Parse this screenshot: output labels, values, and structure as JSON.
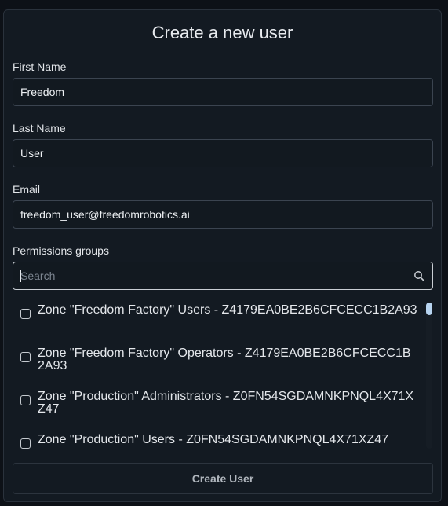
{
  "dialog": {
    "title": "Create a new user"
  },
  "form": {
    "first_name": {
      "label": "First Name",
      "value": "Freedom"
    },
    "last_name": {
      "label": "Last Name",
      "value": "User"
    },
    "email": {
      "label": "Email",
      "value": "freedom_user@freedomrobotics.ai"
    },
    "permissions": {
      "label": "Permissions groups",
      "search_placeholder": "Search",
      "search_icon": "search-icon",
      "items": [
        {
          "label": "Zone \"Freedom Factory\" Users - Z4179EA0BE2B6CFCECC1B2A93",
          "checked": false
        },
        {
          "label": "Zone \"Freedom Factory\" Operators - Z4179EA0BE2B6CFCECC1B2A93",
          "checked": false
        },
        {
          "label": "Zone \"Production\" Administrators - Z0FN54SGDAMNKPNQL4X71XZ47",
          "checked": false
        },
        {
          "label": "Zone \"Production\" Users - Z0FN54SGDAMNKPNQL4X71XZ47",
          "checked": false
        }
      ]
    },
    "submit_label": "Create User"
  },
  "colors": {
    "background": "#0d1117",
    "panel": "#131a22",
    "border": "#3b4450",
    "scroll_thumb": "#b7d4f0"
  }
}
